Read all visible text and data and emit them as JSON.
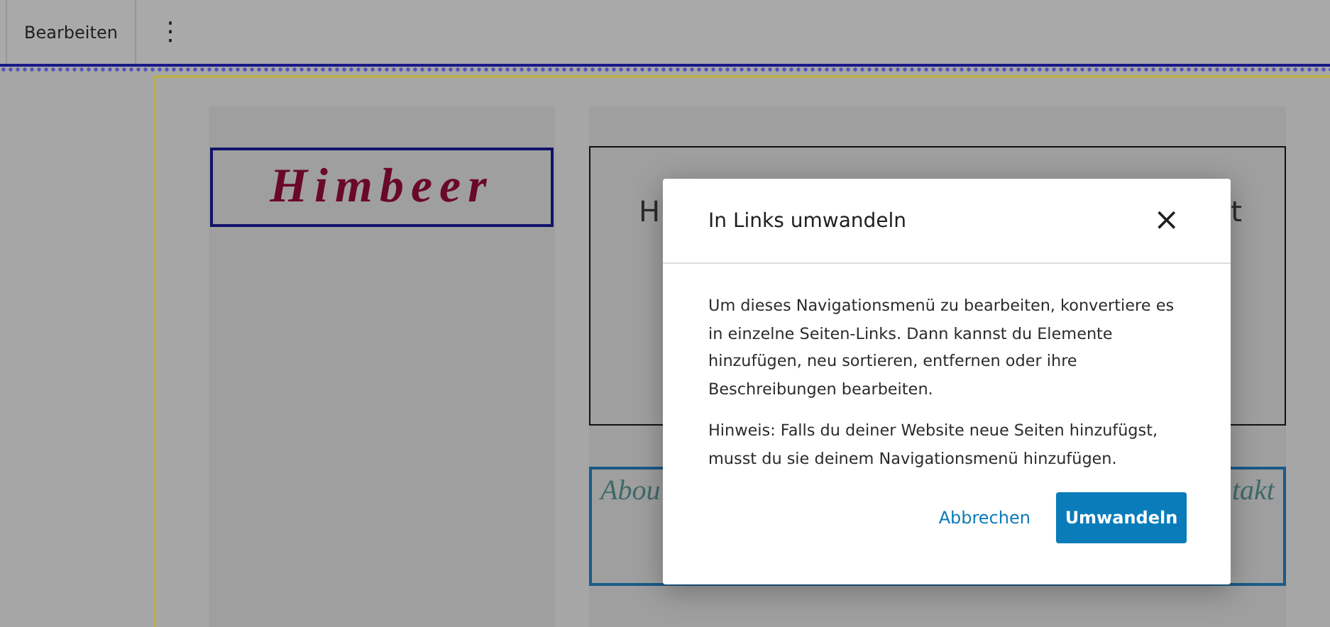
{
  "toolbar": {
    "edit_button": "Bearbeiten",
    "more_button": "⋮"
  },
  "page": {
    "logo": "Himbeer",
    "heading_start": "H",
    "heading_end": "t",
    "nav_start": "Abou",
    "nav_end": "takt"
  },
  "dialog": {
    "title": "In Links umwandeln",
    "close": "×",
    "paragraphs": [
      "Um dieses Navigationsmenü zu bearbeiten, konvertiere es in einzelne Seiten-Links. Dann kannst du Elemente hinzufügen, neu sortieren, entfernen oder ihre Beschreibungen bearbeiten.",
      "Hinweis: Falls du deiner Website neue Seiten hinzufügst, musst du sie deinem Navigationsmenü hinzufügen."
    ],
    "cancel_button": "Abbrechen",
    "confirm_button": "Umwandeln"
  }
}
